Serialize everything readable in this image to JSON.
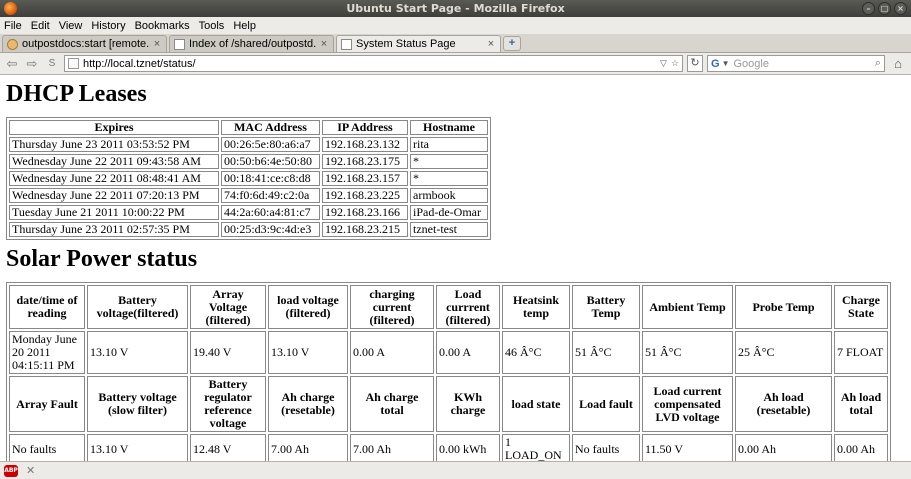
{
  "window": {
    "title": "Ubuntu Start Page - Mozilla Firefox"
  },
  "menubar": [
    "File",
    "Edit",
    "View",
    "History",
    "Bookmarks",
    "Tools",
    "Help"
  ],
  "tabs": [
    {
      "label": "outpostdocs:start [remote...",
      "active": false
    },
    {
      "label": "Index of /shared/outpostd...",
      "active": false
    },
    {
      "label": "System Status Page",
      "active": true
    }
  ],
  "navbar": {
    "url": "http://local.tznet/status/",
    "search_engine": "Google",
    "search_placeholder": "Google"
  },
  "page": {
    "dhcp_title": "DHCP Leases",
    "dhcp_headers": [
      "Expires",
      "MAC Address",
      "IP Address",
      "Hostname"
    ],
    "dhcp_rows": [
      [
        "Thursday June 23 2011 03:53:52 PM",
        "00:26:5e:80:a6:a7",
        "192.168.23.132",
        "rita"
      ],
      [
        "Wednesday June 22 2011 09:43:58 AM",
        "00:50:b6:4e:50:80",
        "192.168.23.175",
        "*"
      ],
      [
        "Wednesday June 22 2011 08:48:41 AM",
        "00:18:41:ce:c8:d8",
        "192.168.23.157",
        "*"
      ],
      [
        "Wednesday June 22 2011 07:20:13 PM",
        "74:f0:6d:49:c2:0a",
        "192.168.23.225",
        "armbook"
      ],
      [
        "Tuesday June 21 2011 10:00:22 PM",
        "44:2a:60:a4:81:c7",
        "192.168.23.166",
        "iPad-de-Omar"
      ],
      [
        "Thursday June 23 2011 02:57:35 PM",
        "00:25:d3:9c:4d:e3",
        "192.168.23.215",
        "tznet-test"
      ]
    ],
    "solar_title": "Solar Power status",
    "solar_headers_1": [
      "date/time of reading",
      "Battery voltage(filtered)",
      "Array Voltage (filtered)",
      "load voltage (filtered)",
      "charging current (filtered)",
      "Load currrent (filtered)",
      "Heatsink temp",
      "Battery Temp",
      "Ambient Temp",
      "Probe Temp",
      "Charge State"
    ],
    "solar_values_1": [
      "Monday June 20 2011 04:15:11 PM",
      "13.10 V",
      "19.40 V",
      "13.10 V",
      "0.00 A",
      "0.00 A",
      "46 Â°C",
      "51 Â°C",
      "51 Â°C",
      "25 Â°C",
      "7 FLOAT"
    ],
    "solar_headers_2": [
      "Array Fault",
      "Battery voltage (slow filter)",
      "Battery regulator reference voltage",
      "Ah charge (resetable)",
      "Ah charge total",
      "KWh charge",
      "load state",
      "Load fault",
      "Load current compensated LVD voltage",
      "Ah load (resetable)",
      "Ah load total"
    ],
    "solar_values_2": [
      "No faults",
      "13.10 V",
      "12.48 V",
      "7.00 Ah",
      "7.00 Ah",
      "0.00 kWh",
      "1 LOAD_ON",
      "No faults",
      "11.50 V",
      "0.00 Ah",
      "0.00 Ah"
    ]
  }
}
